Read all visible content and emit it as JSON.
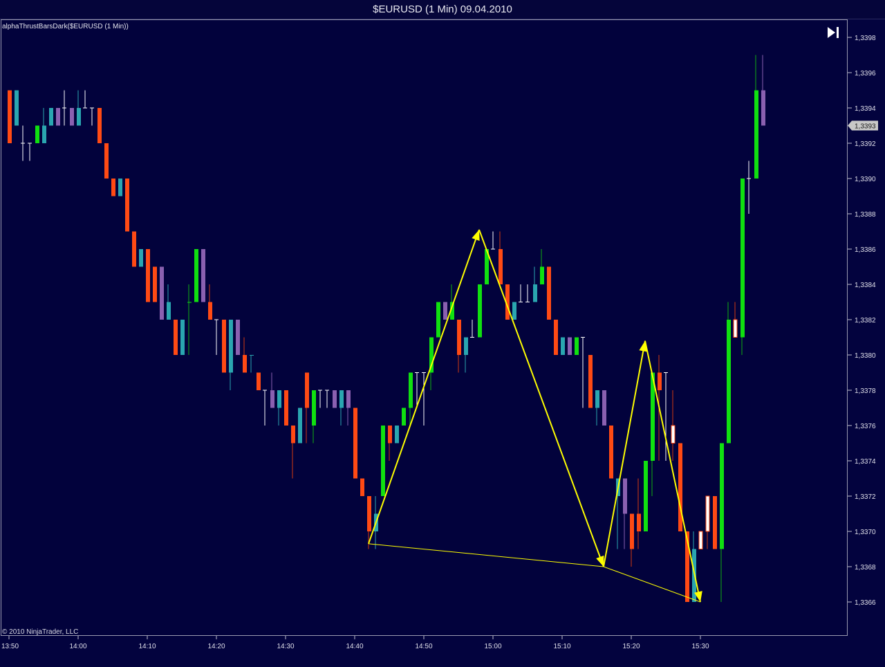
{
  "window": {
    "title": "$EURUSD (1 Min)  09.04.2010"
  },
  "indicator_label": "alphaThrustBarsDark($EURUSD (1 Min))",
  "copyright": "© 2010 NinjaTrader, LLC",
  "price_marker": "1,3393",
  "icons": {
    "scroll_end": "skip-to-end-icon"
  },
  "colors": {
    "background": "#02023c",
    "up_strong": "#10e010",
    "down_strong": "#ff4a14",
    "up_weak": "#2aa6b0",
    "down_weak": "#8a60b0",
    "neutral": "#ffffff",
    "pattern_lines": "#ffff00"
  },
  "chart_data": {
    "type": "candlestick",
    "title": "$EURUSD (1 Min)  09.04.2010",
    "xlabel": "",
    "ylabel": "",
    "ylim": [
      1.33645,
      1.33985
    ],
    "x_ticks": [
      "13:50",
      "14:00",
      "14:10",
      "14:20",
      "14:30",
      "14:40",
      "14:50",
      "15:00",
      "15:10",
      "15:20",
      "15:30"
    ],
    "y_ticks": [
      "1,3366",
      "1,3368",
      "1,3370",
      "1,3372",
      "1,3374",
      "1,3376",
      "1,3378",
      "1,3380",
      "1,3382",
      "1,3384",
      "1,3386",
      "1,3388",
      "1,3390",
      "1,3392",
      "1,3394",
      "1,3396",
      "1,3398"
    ],
    "grid": false,
    "bars": [
      {
        "t": "13:50",
        "o": 1.3395,
        "h": 1.3395,
        "l": 1.3392,
        "c": 1.3392,
        "k": "ds"
      },
      {
        "t": "13:51",
        "o": 1.3393,
        "h": 1.3395,
        "l": 1.3393,
        "c": 1.3395,
        "k": "uw"
      },
      {
        "t": "13:52",
        "o": 1.3392,
        "h": 1.3393,
        "l": 1.3391,
        "c": 1.3392,
        "k": "n"
      },
      {
        "t": "13:53",
        "o": 1.3392,
        "h": 1.3392,
        "l": 1.3391,
        "c": 1.3392,
        "k": "n"
      },
      {
        "t": "13:54",
        "o": 1.3392,
        "h": 1.3393,
        "l": 1.3392,
        "c": 1.3393,
        "k": "us"
      },
      {
        "t": "13:55",
        "o": 1.3392,
        "h": 1.3394,
        "l": 1.3392,
        "c": 1.3393,
        "k": "uw"
      },
      {
        "t": "13:56",
        "o": 1.3393,
        "h": 1.3394,
        "l": 1.3393,
        "c": 1.3394,
        "k": "uw"
      },
      {
        "t": "13:57",
        "o": 1.3394,
        "h": 1.3394,
        "l": 1.3393,
        "c": 1.3393,
        "k": "dw"
      },
      {
        "t": "13:58",
        "o": 1.3393,
        "h": 1.3395,
        "l": 1.3393,
        "c": 1.3394,
        "k": "n"
      },
      {
        "t": "13:59",
        "o": 1.3394,
        "h": 1.3394,
        "l": 1.3393,
        "c": 1.3393,
        "k": "dw"
      },
      {
        "t": "14:00",
        "o": 1.3393,
        "h": 1.3395,
        "l": 1.3393,
        "c": 1.3394,
        "k": "uw"
      },
      {
        "t": "14:01",
        "o": 1.3394,
        "h": 1.3395,
        "l": 1.3394,
        "c": 1.3394,
        "k": "n"
      },
      {
        "t": "14:02",
        "o": 1.3394,
        "h": 1.3394,
        "l": 1.3393,
        "c": 1.3394,
        "k": "n"
      },
      {
        "t": "14:03",
        "o": 1.3394,
        "h": 1.3394,
        "l": 1.3392,
        "c": 1.3392,
        "k": "ds"
      },
      {
        "t": "14:04",
        "o": 1.3392,
        "h": 1.3392,
        "l": 1.339,
        "c": 1.339,
        "k": "ds"
      },
      {
        "t": "14:05",
        "o": 1.339,
        "h": 1.339,
        "l": 1.3389,
        "c": 1.3389,
        "k": "ds"
      },
      {
        "t": "14:06",
        "o": 1.3389,
        "h": 1.339,
        "l": 1.3389,
        "c": 1.339,
        "k": "uw"
      },
      {
        "t": "14:07",
        "o": 1.339,
        "h": 1.339,
        "l": 1.3387,
        "c": 1.3387,
        "k": "ds"
      },
      {
        "t": "14:08",
        "o": 1.3387,
        "h": 1.3387,
        "l": 1.3385,
        "c": 1.3385,
        "k": "ds"
      },
      {
        "t": "14:09",
        "o": 1.3385,
        "h": 1.3386,
        "l": 1.3385,
        "c": 1.3386,
        "k": "uw"
      },
      {
        "t": "14:10",
        "o": 1.3386,
        "h": 1.3386,
        "l": 1.3383,
        "c": 1.3383,
        "k": "ds"
      },
      {
        "t": "14:11",
        "o": 1.3385,
        "h": 1.3385,
        "l": 1.3383,
        "c": 1.3383,
        "k": "ds"
      },
      {
        "t": "14:12",
        "o": 1.3385,
        "h": 1.3385,
        "l": 1.3382,
        "c": 1.3382,
        "k": "dw"
      },
      {
        "t": "14:13",
        "o": 1.3382,
        "h": 1.3384,
        "l": 1.3382,
        "c": 1.3383,
        "k": "uw"
      },
      {
        "t": "14:14",
        "o": 1.3382,
        "h": 1.3382,
        "l": 1.338,
        "c": 1.338,
        "k": "ds"
      },
      {
        "t": "14:15",
        "o": 1.338,
        "h": 1.3382,
        "l": 1.338,
        "c": 1.3382,
        "k": "uw"
      },
      {
        "t": "14:16",
        "o": 1.3383,
        "h": 1.3384,
        "l": 1.338,
        "c": 1.3383,
        "k": "us"
      },
      {
        "t": "14:17",
        "o": 1.3383,
        "h": 1.3386,
        "l": 1.3383,
        "c": 1.3386,
        "k": "us"
      },
      {
        "t": "14:18",
        "o": 1.3386,
        "h": 1.3386,
        "l": 1.3383,
        "c": 1.3383,
        "k": "dw"
      },
      {
        "t": "14:19",
        "o": 1.3383,
        "h": 1.3384,
        "l": 1.3382,
        "c": 1.3382,
        "k": "ds"
      },
      {
        "t": "14:20",
        "o": 1.3382,
        "h": 1.3382,
        "l": 1.338,
        "c": 1.3382,
        "k": "n"
      },
      {
        "t": "14:21",
        "o": 1.3382,
        "h": 1.3382,
        "l": 1.3379,
        "c": 1.3379,
        "k": "ds"
      },
      {
        "t": "14:22",
        "o": 1.3379,
        "h": 1.3382,
        "l": 1.3378,
        "c": 1.3382,
        "k": "uw"
      },
      {
        "t": "14:23",
        "o": 1.3382,
        "h": 1.3382,
        "l": 1.338,
        "c": 1.338,
        "k": "dw"
      },
      {
        "t": "14:24",
        "o": 1.338,
        "h": 1.3381,
        "l": 1.3379,
        "c": 1.3379,
        "k": "ds"
      },
      {
        "t": "14:25",
        "o": 1.338,
        "h": 1.338,
        "l": 1.3379,
        "c": 1.338,
        "k": "uw"
      },
      {
        "t": "14:26",
        "o": 1.3379,
        "h": 1.3379,
        "l": 1.3378,
        "c": 1.3378,
        "k": "ds"
      },
      {
        "t": "14:27",
        "o": 1.3378,
        "h": 1.3378,
        "l": 1.3376,
        "c": 1.3378,
        "k": "n"
      },
      {
        "t": "14:28",
        "o": 1.3378,
        "h": 1.3379,
        "l": 1.3377,
        "c": 1.3377,
        "k": "dw"
      },
      {
        "t": "14:29",
        "o": 1.3377,
        "h": 1.3378,
        "l": 1.3376,
        "c": 1.3378,
        "k": "uw"
      },
      {
        "t": "14:30",
        "o": 1.3378,
        "h": 1.3378,
        "l": 1.3376,
        "c": 1.3376,
        "k": "ds"
      },
      {
        "t": "14:31",
        "o": 1.3376,
        "h": 1.3376,
        "l": 1.3373,
        "c": 1.3375,
        "k": "ds"
      },
      {
        "t": "14:32",
        "o": 1.3375,
        "h": 1.3377,
        "l": 1.3375,
        "c": 1.3377,
        "k": "uw"
      },
      {
        "t": "14:33",
        "o": 1.3379,
        "h": 1.3379,
        "l": 1.3375,
        "c": 1.3377,
        "k": "ds"
      },
      {
        "t": "14:34",
        "o": 1.3376,
        "h": 1.3378,
        "l": 1.3375,
        "c": 1.3378,
        "k": "us"
      },
      {
        "t": "14:35",
        "o": 1.3378,
        "h": 1.3378,
        "l": 1.3377,
        "c": 1.3378,
        "k": "n"
      },
      {
        "t": "14:36",
        "o": 1.3378,
        "h": 1.3378,
        "l": 1.3377,
        "c": 1.3378,
        "k": "n"
      },
      {
        "t": "14:37",
        "o": 1.3378,
        "h": 1.3378,
        "l": 1.3377,
        "c": 1.3377,
        "k": "dw"
      },
      {
        "t": "14:38",
        "o": 1.3377,
        "h": 1.3378,
        "l": 1.3376,
        "c": 1.3378,
        "k": "uw"
      },
      {
        "t": "14:39",
        "o": 1.3378,
        "h": 1.3378,
        "l": 1.3376,
        "c": 1.3377,
        "k": "dw"
      },
      {
        "t": "14:40",
        "o": 1.3377,
        "h": 1.3377,
        "l": 1.3373,
        "c": 1.3373,
        "k": "ds"
      },
      {
        "t": "14:41",
        "o": 1.3373,
        "h": 1.3373,
        "l": 1.3372,
        "c": 1.3372,
        "k": "ds"
      },
      {
        "t": "14:42",
        "o": 1.3372,
        "h": 1.3372,
        "l": 1.3369,
        "c": 1.337,
        "k": "ds"
      },
      {
        "t": "14:43",
        "o": 1.337,
        "h": 1.3372,
        "l": 1.3369,
        "c": 1.3371,
        "k": "uw"
      },
      {
        "t": "14:44",
        "o": 1.3372,
        "h": 1.3376,
        "l": 1.3372,
        "c": 1.3376,
        "k": "us"
      },
      {
        "t": "14:45",
        "o": 1.3376,
        "h": 1.3376,
        "l": 1.3374,
        "c": 1.3375,
        "k": "ds"
      },
      {
        "t": "14:46",
        "o": 1.3375,
        "h": 1.3376,
        "l": 1.3375,
        "c": 1.3376,
        "k": "uw"
      },
      {
        "t": "14:47",
        "o": 1.3376,
        "h": 1.3377,
        "l": 1.3376,
        "c": 1.3377,
        "k": "us"
      },
      {
        "t": "14:48",
        "o": 1.3377,
        "h": 1.3379,
        "l": 1.3376,
        "c": 1.3379,
        "k": "us"
      },
      {
        "t": "14:49",
        "o": 1.3379,
        "h": 1.3379,
        "l": 1.3377,
        "c": 1.3379,
        "k": "n"
      },
      {
        "t": "14:50",
        "o": 1.3379,
        "h": 1.3379,
        "l": 1.3376,
        "c": 1.3379,
        "k": "n"
      },
      {
        "t": "14:51",
        "o": 1.3379,
        "h": 1.3381,
        "l": 1.3378,
        "c": 1.3381,
        "k": "us"
      },
      {
        "t": "14:52",
        "o": 1.3381,
        "h": 1.3383,
        "l": 1.3381,
        "c": 1.3383,
        "k": "us"
      },
      {
        "t": "14:53",
        "o": 1.3383,
        "h": 1.3383,
        "l": 1.3382,
        "c": 1.3382,
        "k": "dw"
      },
      {
        "t": "14:54",
        "o": 1.3382,
        "h": 1.3384,
        "l": 1.3382,
        "c": 1.3383,
        "k": "us"
      },
      {
        "t": "14:55",
        "o": 1.3382,
        "h": 1.3382,
        "l": 1.3379,
        "c": 1.338,
        "k": "ds"
      },
      {
        "t": "14:56",
        "o": 1.338,
        "h": 1.3381,
        "l": 1.3379,
        "c": 1.3381,
        "k": "uw"
      },
      {
        "t": "14:57",
        "o": 1.3381,
        "h": 1.3382,
        "l": 1.3381,
        "c": 1.3381,
        "k": "n"
      },
      {
        "t": "14:58",
        "o": 1.3381,
        "h": 1.3384,
        "l": 1.3381,
        "c": 1.3384,
        "k": "us"
      },
      {
        "t": "14:59",
        "o": 1.3384,
        "h": 1.3386,
        "l": 1.3384,
        "c": 1.3386,
        "k": "us"
      },
      {
        "t": "15:00",
        "o": 1.3386,
        "h": 1.3387,
        "l": 1.3386,
        "c": 1.3386,
        "k": "n"
      },
      {
        "t": "15:01",
        "o": 1.3386,
        "h": 1.3387,
        "l": 1.3384,
        "c": 1.3384,
        "k": "ds"
      },
      {
        "t": "15:02",
        "o": 1.3384,
        "h": 1.3384,
        "l": 1.3382,
        "c": 1.3382,
        "k": "ds"
      },
      {
        "t": "15:03",
        "o": 1.3382,
        "h": 1.3383,
        "l": 1.3382,
        "c": 1.3383,
        "k": "uw"
      },
      {
        "t": "15:04",
        "o": 1.3383,
        "h": 1.3384,
        "l": 1.3383,
        "c": 1.3383,
        "k": "n"
      },
      {
        "t": "15:05",
        "o": 1.3383,
        "h": 1.3384,
        "l": 1.3383,
        "c": 1.3383,
        "k": "n"
      },
      {
        "t": "15:06",
        "o": 1.3383,
        "h": 1.3385,
        "l": 1.3383,
        "c": 1.3384,
        "k": "uw"
      },
      {
        "t": "15:07",
        "o": 1.3384,
        "h": 1.3386,
        "l": 1.3384,
        "c": 1.3385,
        "k": "us"
      },
      {
        "t": "15:08",
        "o": 1.3385,
        "h": 1.3385,
        "l": 1.3382,
        "c": 1.3382,
        "k": "ds"
      },
      {
        "t": "15:09",
        "o": 1.3382,
        "h": 1.3382,
        "l": 1.338,
        "c": 1.338,
        "k": "ds"
      },
      {
        "t": "15:10",
        "o": 1.338,
        "h": 1.3381,
        "l": 1.338,
        "c": 1.3381,
        "k": "uw"
      },
      {
        "t": "15:11",
        "o": 1.3381,
        "h": 1.3381,
        "l": 1.338,
        "c": 1.338,
        "k": "dw"
      },
      {
        "t": "15:12",
        "o": 1.338,
        "h": 1.3381,
        "l": 1.338,
        "c": 1.3381,
        "k": "us"
      },
      {
        "t": "15:13",
        "o": 1.3381,
        "h": 1.3381,
        "l": 1.3377,
        "c": 1.338,
        "k": "n"
      },
      {
        "t": "15:14",
        "o": 1.338,
        "h": 1.338,
        "l": 1.3377,
        "c": 1.3377,
        "k": "ds"
      },
      {
        "t": "15:15",
        "o": 1.3377,
        "h": 1.3378,
        "l": 1.3376,
        "c": 1.3378,
        "k": "uw"
      },
      {
        "t": "15:16",
        "o": 1.3378,
        "h": 1.3378,
        "l": 1.3376,
        "c": 1.3376,
        "k": "dw"
      },
      {
        "t": "15:17",
        "o": 1.3376,
        "h": 1.3376,
        "l": 1.3373,
        "c": 1.3373,
        "k": "ds"
      },
      {
        "t": "15:18",
        "o": 1.3373,
        "h": 1.3373,
        "l": 1.3369,
        "c": 1.3372,
        "k": "uw"
      },
      {
        "t": "15:19",
        "o": 1.3373,
        "h": 1.3373,
        "l": 1.3369,
        "c": 1.3371,
        "k": "dw"
      },
      {
        "t": "15:20",
        "o": 1.3371,
        "h": 1.3371,
        "l": 1.3368,
        "c": 1.3369,
        "k": "ds"
      },
      {
        "t": "15:21",
        "o": 1.337,
        "h": 1.3373,
        "l": 1.3369,
        "c": 1.3371,
        "k": "ds"
      },
      {
        "t": "15:22",
        "o": 1.337,
        "h": 1.3374,
        "l": 1.337,
        "c": 1.3374,
        "k": "us"
      },
      {
        "t": "15:23",
        "o": 1.3374,
        "h": 1.3379,
        "l": 1.3372,
        "c": 1.3379,
        "k": "us"
      },
      {
        "t": "15:24",
        "o": 1.3379,
        "h": 1.338,
        "l": 1.3374,
        "c": 1.3378,
        "k": "ds"
      },
      {
        "t": "15:25",
        "o": 1.3378,
        "h": 1.3379,
        "l": 1.3374,
        "c": 1.3379,
        "k": "n"
      },
      {
        "t": "15:26",
        "o": 1.3375,
        "h": 1.3378,
        "l": 1.3374,
        "c": 1.3376,
        "k": "hw"
      },
      {
        "t": "15:27",
        "o": 1.3375,
        "h": 1.3375,
        "l": 1.337,
        "c": 1.337,
        "k": "ds"
      },
      {
        "t": "15:28",
        "o": 1.337,
        "h": 1.337,
        "l": 1.3366,
        "c": 1.3366,
        "k": "ds"
      },
      {
        "t": "15:29",
        "o": 1.3366,
        "h": 1.337,
        "l": 1.3366,
        "c": 1.3369,
        "k": "uw"
      },
      {
        "t": "15:30",
        "o": 1.3369,
        "h": 1.337,
        "l": 1.3369,
        "c": 1.337,
        "k": "hw"
      },
      {
        "t": "15:31",
        "o": 1.337,
        "h": 1.3372,
        "l": 1.3369,
        "c": 1.3372,
        "k": "hw"
      },
      {
        "t": "15:32",
        "o": 1.3372,
        "h": 1.3372,
        "l": 1.3369,
        "c": 1.3369,
        "k": "ds"
      },
      {
        "t": "15:33",
        "o": 1.3369,
        "h": 1.3375,
        "l": 1.3366,
        "c": 1.3375,
        "k": "us"
      },
      {
        "t": "15:34",
        "o": 1.3375,
        "h": 1.3383,
        "l": 1.3375,
        "c": 1.3382,
        "k": "us"
      },
      {
        "t": "15:35",
        "o": 1.3382,
        "h": 1.3383,
        "l": 1.3381,
        "c": 1.3381,
        "k": "hw"
      },
      {
        "t": "15:36",
        "o": 1.3381,
        "h": 1.339,
        "l": 1.338,
        "c": 1.339,
        "k": "us"
      },
      {
        "t": "15:37",
        "o": 1.339,
        "h": 1.3391,
        "l": 1.3388,
        "c": 1.339,
        "k": "n"
      },
      {
        "t": "15:38",
        "o": 1.339,
        "h": 1.3397,
        "l": 1.339,
        "c": 1.3395,
        "k": "us"
      },
      {
        "t": "15:39",
        "o": 1.3395,
        "h": 1.3397,
        "l": 1.3393,
        "c": 1.3393,
        "k": "dw"
      }
    ],
    "annotations": [
      {
        "type": "zigzag",
        "color": "#ffff00",
        "points": [
          {
            "t": "14:42",
            "p": 1.33693
          },
          {
            "t": "14:58",
            "p": 1.33871
          },
          {
            "t": "15:16",
            "p": 1.3368
          },
          {
            "t": "15:22",
            "p": 1.33808
          },
          {
            "t": "15:30",
            "p": 1.3366
          }
        ]
      },
      {
        "type": "line",
        "color": "#ffff00",
        "points": [
          {
            "t": "14:42",
            "p": 1.33693
          },
          {
            "t": "15:16",
            "p": 1.3368
          },
          {
            "t": "15:30",
            "p": 1.3366
          }
        ]
      }
    ]
  }
}
